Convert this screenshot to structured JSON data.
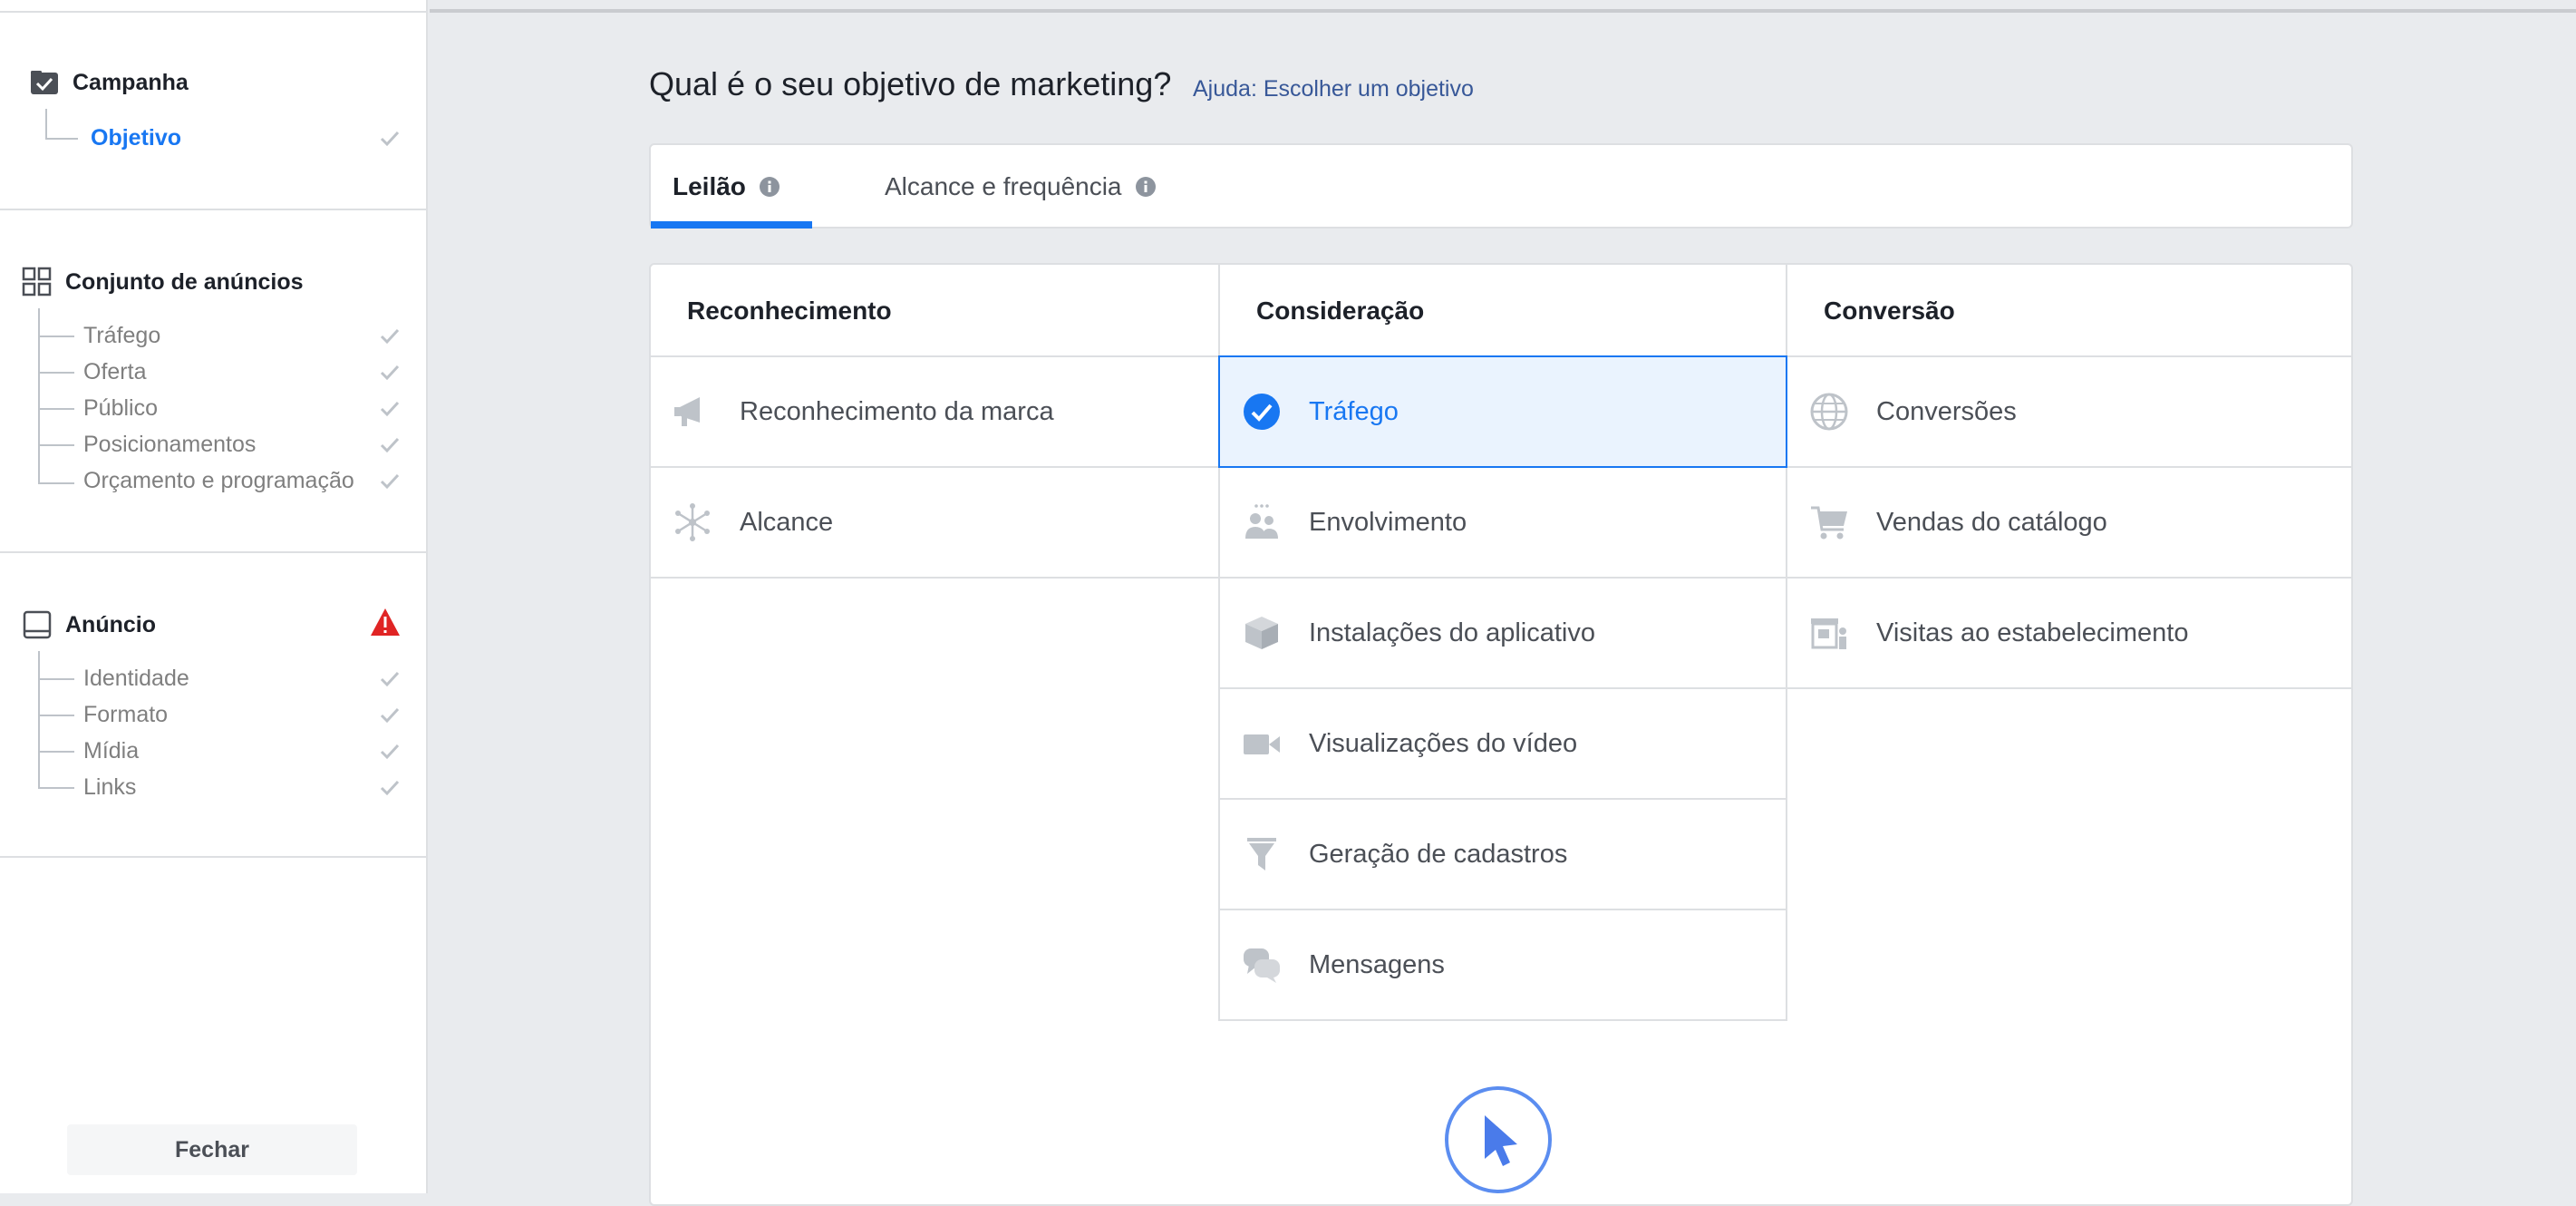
{
  "sidebar": {
    "campaign": {
      "title": "Campanha",
      "items": [
        {
          "label": "Objetivo"
        }
      ]
    },
    "adset": {
      "title": "Conjunto de anúncios",
      "items": [
        {
          "label": "Tráfego"
        },
        {
          "label": "Oferta"
        },
        {
          "label": "Público"
        },
        {
          "label": "Posicionamentos"
        },
        {
          "label": "Orçamento e programação"
        }
      ]
    },
    "ad": {
      "title": "Anúncio",
      "items": [
        {
          "label": "Identidade"
        },
        {
          "label": "Formato"
        },
        {
          "label": "Mídia"
        },
        {
          "label": "Links"
        }
      ]
    },
    "close_label": "Fechar"
  },
  "main": {
    "question": "Qual é o seu objetivo de marketing?",
    "help_link": "Ajuda: Escolher um objetivo",
    "tabs": [
      {
        "label": "Leilão"
      },
      {
        "label": "Alcance e frequência"
      }
    ],
    "columns": [
      {
        "title": "Reconhecimento",
        "items": [
          {
            "label": "Reconhecimento da marca",
            "icon": "megaphone-icon"
          },
          {
            "label": "Alcance",
            "icon": "reach-icon"
          }
        ]
      },
      {
        "title": "Consideração",
        "items": [
          {
            "label": "Tráfego",
            "icon": "check-circle-icon"
          },
          {
            "label": "Envolvimento",
            "icon": "people-icon"
          },
          {
            "label": "Instalações do aplicativo",
            "icon": "box-icon"
          },
          {
            "label": "Visualizações do vídeo",
            "icon": "video-camera-icon"
          },
          {
            "label": "Geração de cadastros",
            "icon": "funnel-icon"
          },
          {
            "label": "Mensagens",
            "icon": "chat-bubbles-icon"
          }
        ]
      },
      {
        "title": "Conversão",
        "items": [
          {
            "label": "Conversões",
            "icon": "globe-icon"
          },
          {
            "label": "Vendas do catálogo",
            "icon": "cart-icon"
          },
          {
            "label": "Visitas ao estabelecimento",
            "icon": "store-icon"
          }
        ]
      }
    ]
  },
  "colors": {
    "accent": "#1877f2",
    "warning": "#e02424",
    "icon_gray": "#bec3c9",
    "selected_bg": "#eaf3fe"
  }
}
